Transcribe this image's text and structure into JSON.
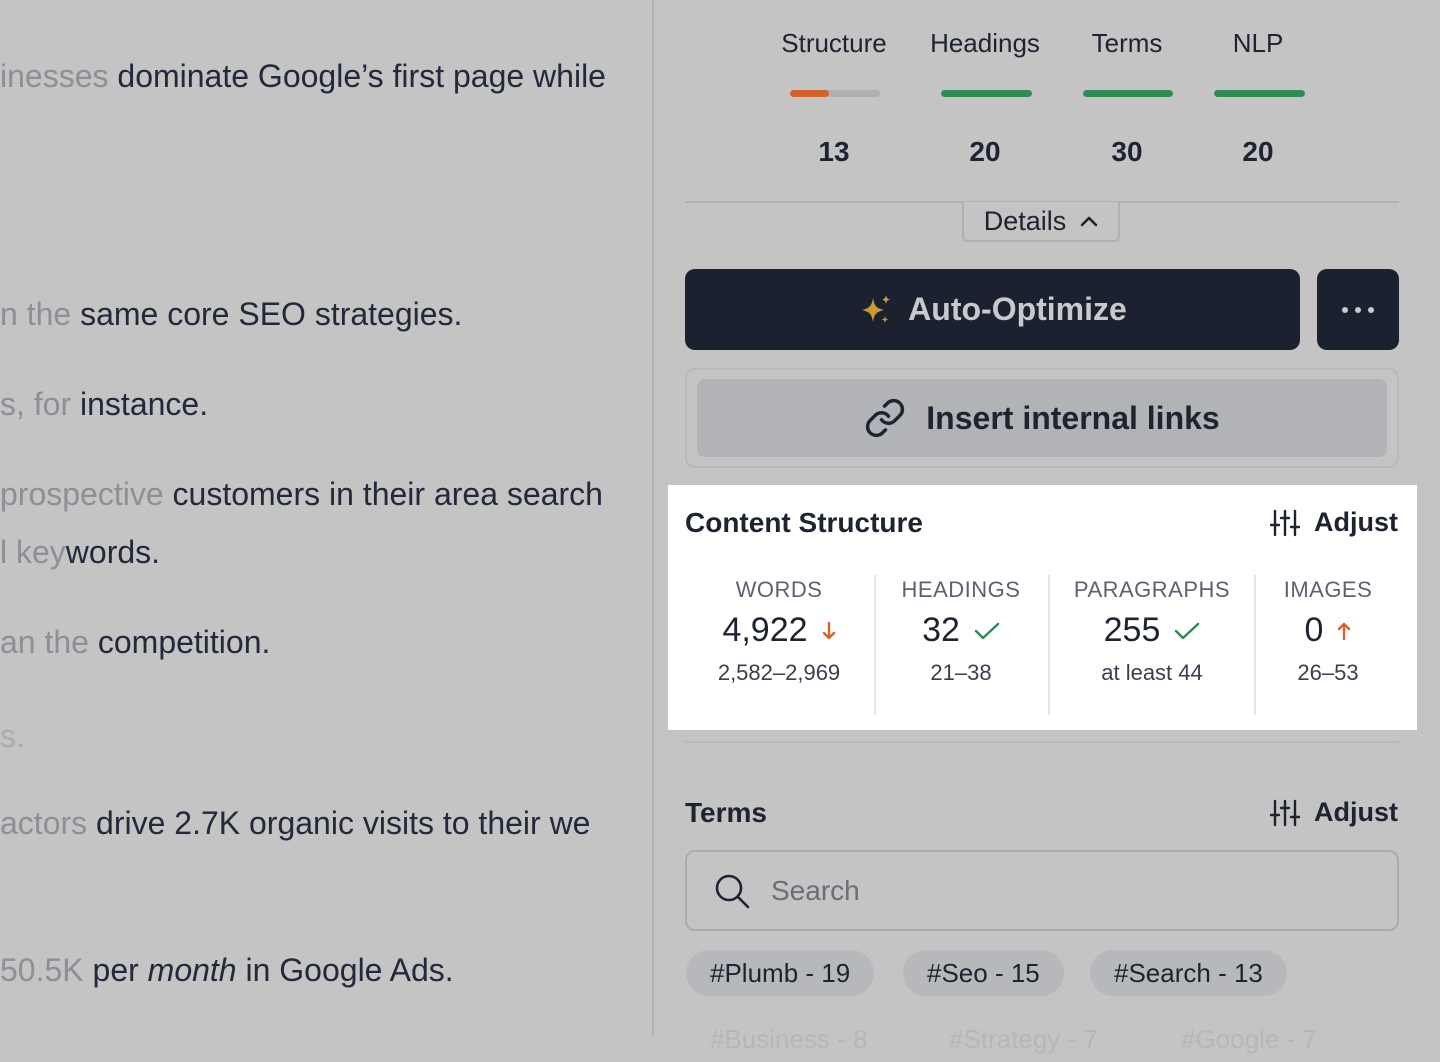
{
  "editor": {
    "lines": [
      {
        "fade": "inesses",
        "text": " dominate Google’s first page while"
      },
      {
        "fade": "n the",
        "text": " same core SEO strategies."
      },
      {
        "fade": "s, for",
        "text": " instance."
      },
      {
        "fade": "prospective",
        "text": " customers in their area search"
      },
      {
        "fade": "l key",
        "text": "words."
      },
      {
        "fade": "an the",
        "text": " competition."
      },
      {
        "fade": "s.",
        "text": ""
      },
      {
        "fade": "actors",
        "text": " drive 2.7K organic visits to their we"
      },
      {
        "fade": "50.5K",
        "text": " per ",
        "em": "month",
        "tail": " in Google Ads."
      }
    ]
  },
  "scores": [
    {
      "label": "Structure",
      "value": "13",
      "fill": 0.43,
      "color": "#d4622c"
    },
    {
      "label": "Headings",
      "value": "20",
      "fill": 1.0,
      "color": "#2f8a55"
    },
    {
      "label": "Terms",
      "value": "30",
      "fill": 1.0,
      "color": "#2f8a55"
    },
    {
      "label": "NLP",
      "value": "20",
      "fill": 1.0,
      "color": "#2f8a55"
    }
  ],
  "details_label": "Details",
  "auto_optimize_label": "Auto-Optimize",
  "insert_links_label": "Insert internal links",
  "content_structure": {
    "title": "Content Structure",
    "adjust_label": "Adjust",
    "stats": [
      {
        "label": "WORDS",
        "value": "4,922",
        "range": "2,582–2,969",
        "status": "down"
      },
      {
        "label": "HEADINGS",
        "value": "32",
        "range": "21–38",
        "status": "ok"
      },
      {
        "label": "PARAGRAPHS",
        "value": "255",
        "range": "at least 44",
        "status": "ok"
      },
      {
        "label": "IMAGES",
        "value": "0",
        "range": "26–53",
        "status": "up"
      }
    ]
  },
  "terms": {
    "title": "Terms",
    "adjust_label": "Adjust",
    "search_placeholder": "Search",
    "tags": [
      "#Plumb - 19",
      "#Seo - 15",
      "#Search - 13"
    ],
    "faded_tags": [
      "#Business - 8",
      "#Strategy - 7",
      "#Google - 7"
    ]
  },
  "colors": {
    "accent_dark": "#1c2130",
    "ok": "#2f8a55",
    "warn": "#d4622c"
  }
}
